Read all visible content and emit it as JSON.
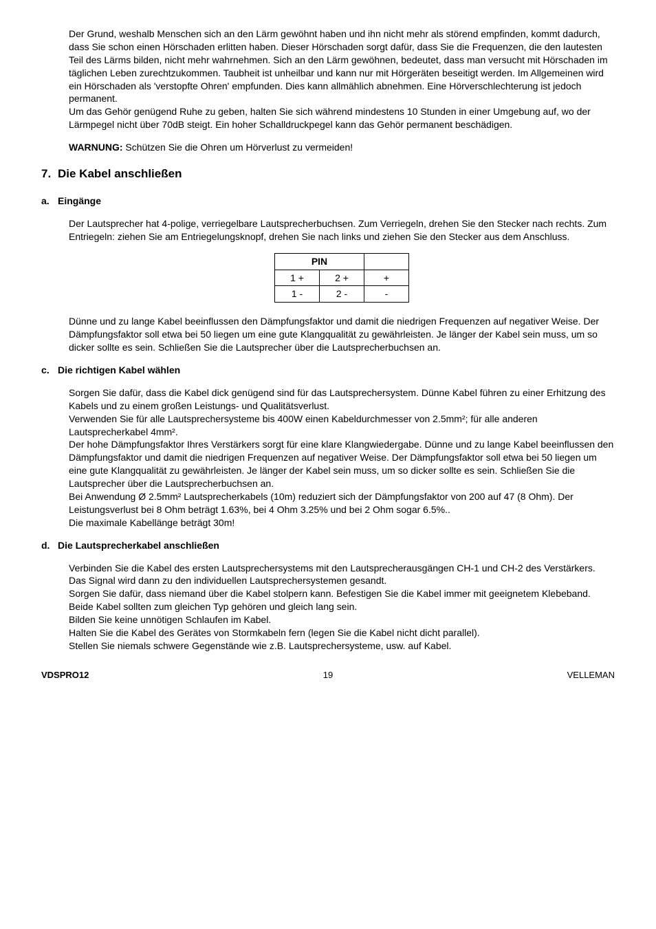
{
  "intro": {
    "para1": "Der Grund, weshalb Menschen sich an den Lärm gewöhnt haben und ihn nicht mehr als störend empfinden, kommt dadurch, dass Sie schon einen Hörschaden erlitten haben. Dieser Hörschaden sorgt dafür, dass Sie die Frequenzen, die den lautesten Teil des Lärms bilden, nicht mehr wahrnehmen. Sich an den Lärm gewöhnen, bedeutet, dass man versucht mit Hörschaden im täglichen Leben zurechtzukommen. Taubheit ist unheilbar und kann nur mit Hörgeräten beseitigt werden. Im Allgemeinen wird ein Hörschaden als 'verstopfte Ohren' empfunden. Dies kann allmählich abnehmen. Eine Hörverschlechterung ist jedoch permanent.",
    "para2": "Um das Gehör genügend Ruhe zu geben, halten Sie sich während mindestens 10 Stunden in einer Umgebung auf, wo der Lärmpegel nicht über 70dB steigt. Ein hoher Schalldruckpegel kann das Gehör permanent beschädigen.",
    "warning_label": "WARNUNG:",
    "warning_text": " Schützen Sie die Ohren um Hörverlust zu vermeiden!"
  },
  "section7": {
    "num": "7.",
    "title": "Die Kabel anschließen",
    "a": {
      "letter": "a.",
      "title": "Eingänge",
      "para1": "Der Lautsprecher hat 4-polige, verriegelbare Lautsprecherbuchsen. Zum Verriegeln, drehen Sie den Stecker nach rechts. Zum Entriegeln: ziehen Sie am Entriegelungsknopf, drehen Sie nach links und ziehen Sie den Stecker aus dem Anschluss.",
      "table": {
        "header": "PIN",
        "r1c1": "1 +",
        "r1c2": "2 +",
        "r1c3": "+",
        "r2c1": "1 -",
        "r2c2": "2 -",
        "r2c3": "-"
      },
      "para2": "Dünne und zu lange Kabel beeinflussen den Dämpfungsfaktor und damit die niedrigen Frequenzen auf negativer Weise. Der Dämpfungsfaktor soll etwa bei 50 liegen um eine gute Klangqualität zu gewährleisten. Je länger der Kabel sein muss, um so dicker sollte es sein. Schließen Sie die Lautsprecher über die Lautsprecherbuchsen an."
    },
    "c": {
      "letter": "c.",
      "title": "Die richtigen Kabel wählen",
      "para1": "Sorgen Sie dafür, dass die Kabel dick genügend sind für das Lautsprechersystem. Dünne Kabel führen zu einer Erhitzung des Kabels und zu einem großen Leistungs- und Qualitätsverlust.",
      "para2": "Verwenden Sie für alle Lautsprechersysteme bis 400W einen Kabeldurchmesser von 2.5mm²; für alle anderen Lautsprecherkabel 4mm².",
      "para3": "Der hohe Dämpfungsfaktor Ihres Verstärkers sorgt für eine klare Klangwiedergabe. Dünne und zu lange Kabel beeinflussen den Dämpfungsfaktor und damit die niedrigen Frequenzen auf  negativer Weise. Der Dämpfungsfaktor soll etwa bei 50 liegen um eine gute Klangqualität zu gewährleisten. Je länger der Kabel sein muss, um so dicker sollte es sein. Schließen Sie die Lautsprecher über die Lautsprecherbuchsen an.",
      "para4": "Bei Anwendung Ø 2.5mm² Lautsprecherkabels (10m) reduziert sich der Dämpfungsfaktor von 200 auf 47 (8 Ohm). Der Leistungsverlust bei 8 Ohm beträgt 1.63%, bei 4 Ohm 3.25% und bei 2 Ohm sogar 6.5%..",
      "para5": "Die maximale Kabellänge beträgt 30m!"
    },
    "d": {
      "letter": "d.",
      "title": "Die Lautsprecherkabel anschließen",
      "para1": "Verbinden Sie die Kabel des ersten Lautsprechersystems mit den Lautsprecherausgängen CH-1 und CH-2 des Verstärkers. Das Signal wird dann zu den individuellen Lautsprechersystemen gesandt.",
      "para2": "Sorgen Sie dafür, dass niemand über die Kabel stolpern kann. Befestigen Sie die Kabel immer mit geeignetem Klebeband.",
      "para3": "Beide Kabel sollten zum gleichen Typ gehören und gleich lang sein.",
      "para4": "Bilden Sie keine unnötigen Schlaufen im Kabel.",
      "para5": "Halten Sie die Kabel des Gerätes von Stormkabeln fern (legen Sie die Kabel nicht dicht parallel).",
      "para6": "Stellen Sie niemals schwere Gegenstände wie z.B. Lautsprechersysteme, usw. auf Kabel."
    }
  },
  "footer": {
    "left": "VDSPRO12",
    "center": "19",
    "right": "VELLEMAN"
  }
}
